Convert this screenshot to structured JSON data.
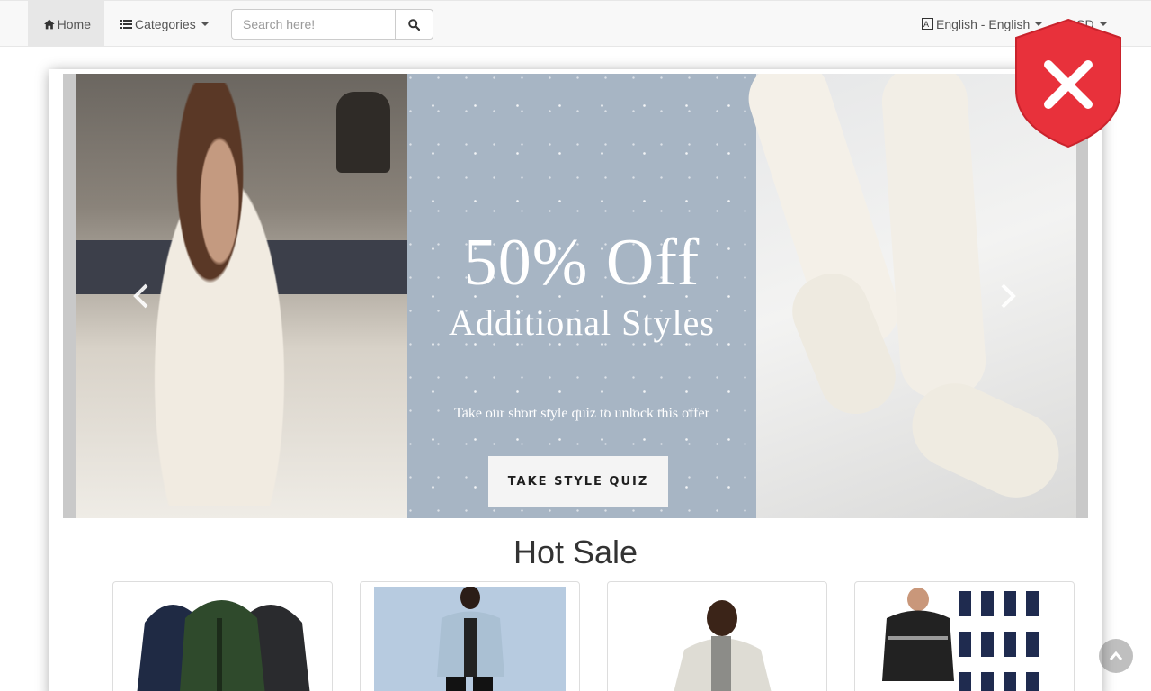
{
  "nav": {
    "home_label": "Home",
    "categories_label": "Categories",
    "search_placeholder": "Search here!",
    "language_label": "English - English",
    "currency_label": "USD"
  },
  "carousel": {
    "promo_title": "50% Off",
    "promo_subtitle": "Additional Styles",
    "promo_note": "Take our short style quiz to unlock this offer",
    "cta_label": "TAKE STYLE QUIZ"
  },
  "hot_sale": {
    "title": "Hot Sale",
    "products": [
      {
        "icon": "puffer-jackets"
      },
      {
        "icon": "denim-jacket"
      },
      {
        "icon": "white-puffer-jacket"
      },
      {
        "icon": "black-windbreaker-jacket"
      }
    ]
  },
  "colors": {
    "navbar_bg": "#f8f8f8",
    "active_nav_bg": "#e7e7e7",
    "shield_red": "#e8313b",
    "promo_bg": "#a7b5c4"
  }
}
